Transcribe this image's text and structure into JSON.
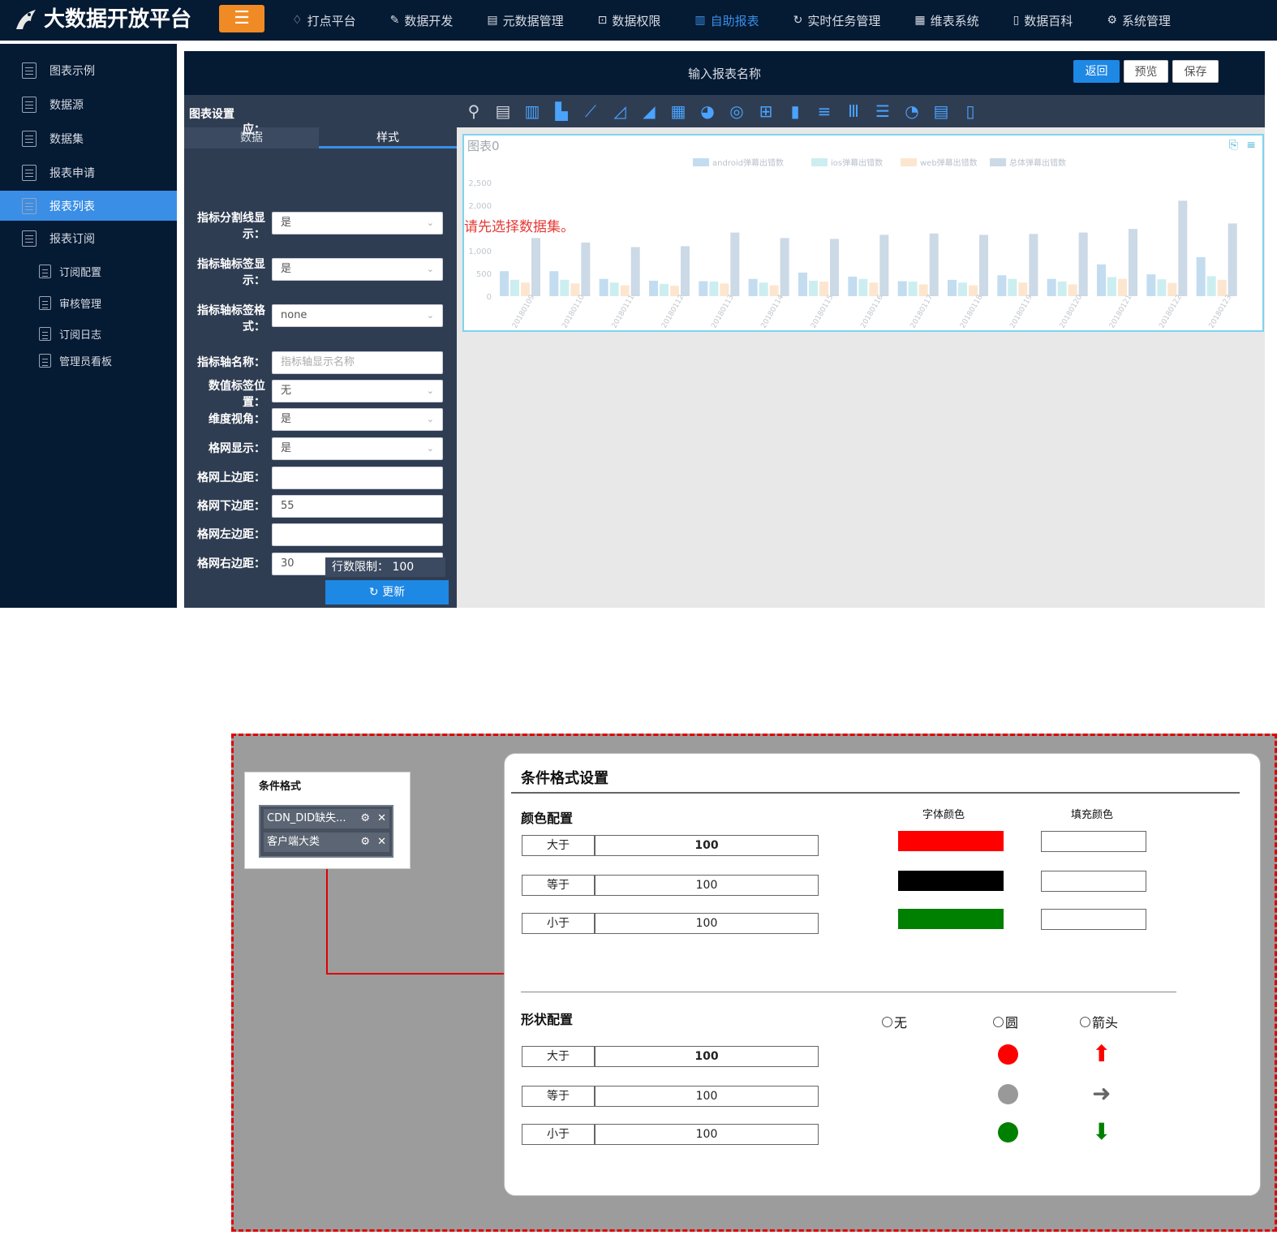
{
  "app": {
    "title": "大数据开放平台",
    "menu_toggle_icon": "menu-icon"
  },
  "nav": [
    {
      "label": "打点平台",
      "icon": "bulb-icon",
      "active": false
    },
    {
      "label": "数据开发",
      "icon": "pen-icon",
      "active": false
    },
    {
      "label": "元数据管理",
      "icon": "file-icon",
      "active": false
    },
    {
      "label": "数据权限",
      "icon": "lock-icon",
      "active": false
    },
    {
      "label": "自助报表",
      "icon": "bar-chart-icon",
      "active": true
    },
    {
      "label": "实时任务管理",
      "icon": "refresh-icon",
      "active": false
    },
    {
      "label": "维表系统",
      "icon": "table-icon",
      "active": false
    },
    {
      "label": "数据百科",
      "icon": "book-icon",
      "active": false
    },
    {
      "label": "系统管理",
      "icon": "gear-icon",
      "active": false
    }
  ],
  "sidebar": {
    "items": [
      {
        "label": "图表示例",
        "active": false,
        "sub": false
      },
      {
        "label": "数据源",
        "active": false,
        "sub": false
      },
      {
        "label": "数据集",
        "active": false,
        "sub": false
      },
      {
        "label": "报表申请",
        "active": false,
        "sub": false
      },
      {
        "label": "报表列表",
        "active": true,
        "sub": false
      },
      {
        "label": "报表订阅",
        "active": false,
        "sub": false
      },
      {
        "label": "订阅配置",
        "active": false,
        "sub": true
      },
      {
        "label": "审核管理",
        "active": false,
        "sub": true
      },
      {
        "label": "订阅日志",
        "active": false,
        "sub": true
      },
      {
        "label": "管理员看板",
        "active": false,
        "sub": true
      }
    ]
  },
  "editor": {
    "report_name_placeholder": "输入报表名称",
    "back_label": "返回",
    "preview_label": "预览",
    "save_label": "保存",
    "settings_title": "图表设置",
    "tab_data": "数据",
    "tab_style": "样式",
    "fields": [
      {
        "label": "应：",
        "value": "",
        "type": "none"
      },
      {
        "label": "指标分割线显示：",
        "value": "是",
        "type": "select"
      },
      {
        "label": "指标轴标签显示：",
        "value": "是",
        "type": "select"
      },
      {
        "label": "指标轴标签格式：",
        "value": "none",
        "type": "select"
      },
      {
        "label": "指标轴名称：",
        "value": "",
        "placeholder": "指标轴显示名称",
        "type": "input"
      },
      {
        "label": "数值标签位置：",
        "value": "无",
        "type": "select"
      },
      {
        "label": "维度视角：",
        "value": "是",
        "type": "select"
      },
      {
        "label": "格网显示：",
        "value": "是",
        "type": "select"
      },
      {
        "label": "格网上边距：",
        "value": "",
        "type": "input"
      },
      {
        "label": "格网下边距：",
        "value": "55",
        "type": "input"
      },
      {
        "label": "格网左边距：",
        "value": "",
        "type": "input"
      },
      {
        "label": "格网右边距：",
        "value": "30",
        "type": "input"
      }
    ],
    "row_limit_label": "行数限制：",
    "row_limit_value": "100",
    "update_label": "更新",
    "chart_name": "图表0",
    "warning": "请先选择数据集。"
  },
  "chart_data": {
    "type": "bar",
    "title": "图表0",
    "categories": [
      "20180109",
      "20180110",
      "20180111",
      "20180112",
      "20180113",
      "20180114",
      "20180115",
      "20180116",
      "20180117",
      "20180118",
      "20180119",
      "20180120",
      "20180121",
      "20180122",
      "20180123"
    ],
    "series": [
      {
        "name": "android弹幕出错数",
        "color": "#c3dcf0",
        "values": [
          550,
          550,
          380,
          340,
          330,
          380,
          520,
          430,
          330,
          360,
          460,
          380,
          700,
          480,
          860
        ]
      },
      {
        "name": "ios弹幕出错数",
        "color": "#cdeef0",
        "values": [
          360,
          360,
          300,
          270,
          320,
          300,
          340,
          380,
          320,
          300,
          380,
          320,
          420,
          370,
          440
        ]
      },
      {
        "name": "web弹幕出错数",
        "color": "#fde6cf",
        "values": [
          300,
          280,
          240,
          230,
          280,
          240,
          320,
          300,
          260,
          240,
          300,
          260,
          380,
          290,
          360
        ]
      },
      {
        "name": "总体弹幕出错数",
        "color": "#ccd9e6",
        "values": [
          1280,
          1180,
          1080,
          1100,
          1400,
          1280,
          1260,
          1350,
          1380,
          1350,
          1370,
          1400,
          1480,
          2100,
          1600
        ]
      }
    ],
    "yticks": [
      "2,500",
      "2,000",
      "1,000",
      "500",
      "0"
    ],
    "ylim": [
      0,
      2500
    ],
    "legend_position": "top"
  },
  "diagram": {
    "cf_title": "条件格式",
    "cf_items": [
      "CDN_DID缺失...",
      "客户端大类"
    ],
    "panel_title": "条件格式设置",
    "color_section": "颜色配置",
    "font_color_head": "字体颜色",
    "fill_color_head": "填充颜色",
    "color_rules": [
      {
        "op": "大于",
        "value": "100",
        "font_color": "#ff0000"
      },
      {
        "op": "等于",
        "value": "100",
        "font_color": "#000000"
      },
      {
        "op": "小于",
        "value": "100",
        "font_color": "#008000"
      }
    ],
    "shape_section": "形状配置",
    "shape_options": [
      "无",
      "圆",
      "箭头"
    ],
    "shape_rules": [
      {
        "op": "大于",
        "value": "100",
        "circle_color": "#ff0000",
        "arrow": "up-arrow-icon",
        "arrow_color": "#ff0000"
      },
      {
        "op": "等于",
        "value": "100",
        "circle_color": "#999999",
        "arrow": "right-arrow-icon",
        "arrow_color": "#666666"
      },
      {
        "op": "小于",
        "value": "100",
        "circle_color": "#008000",
        "arrow": "down-arrow-icon",
        "arrow_color": "#008000"
      }
    ]
  }
}
